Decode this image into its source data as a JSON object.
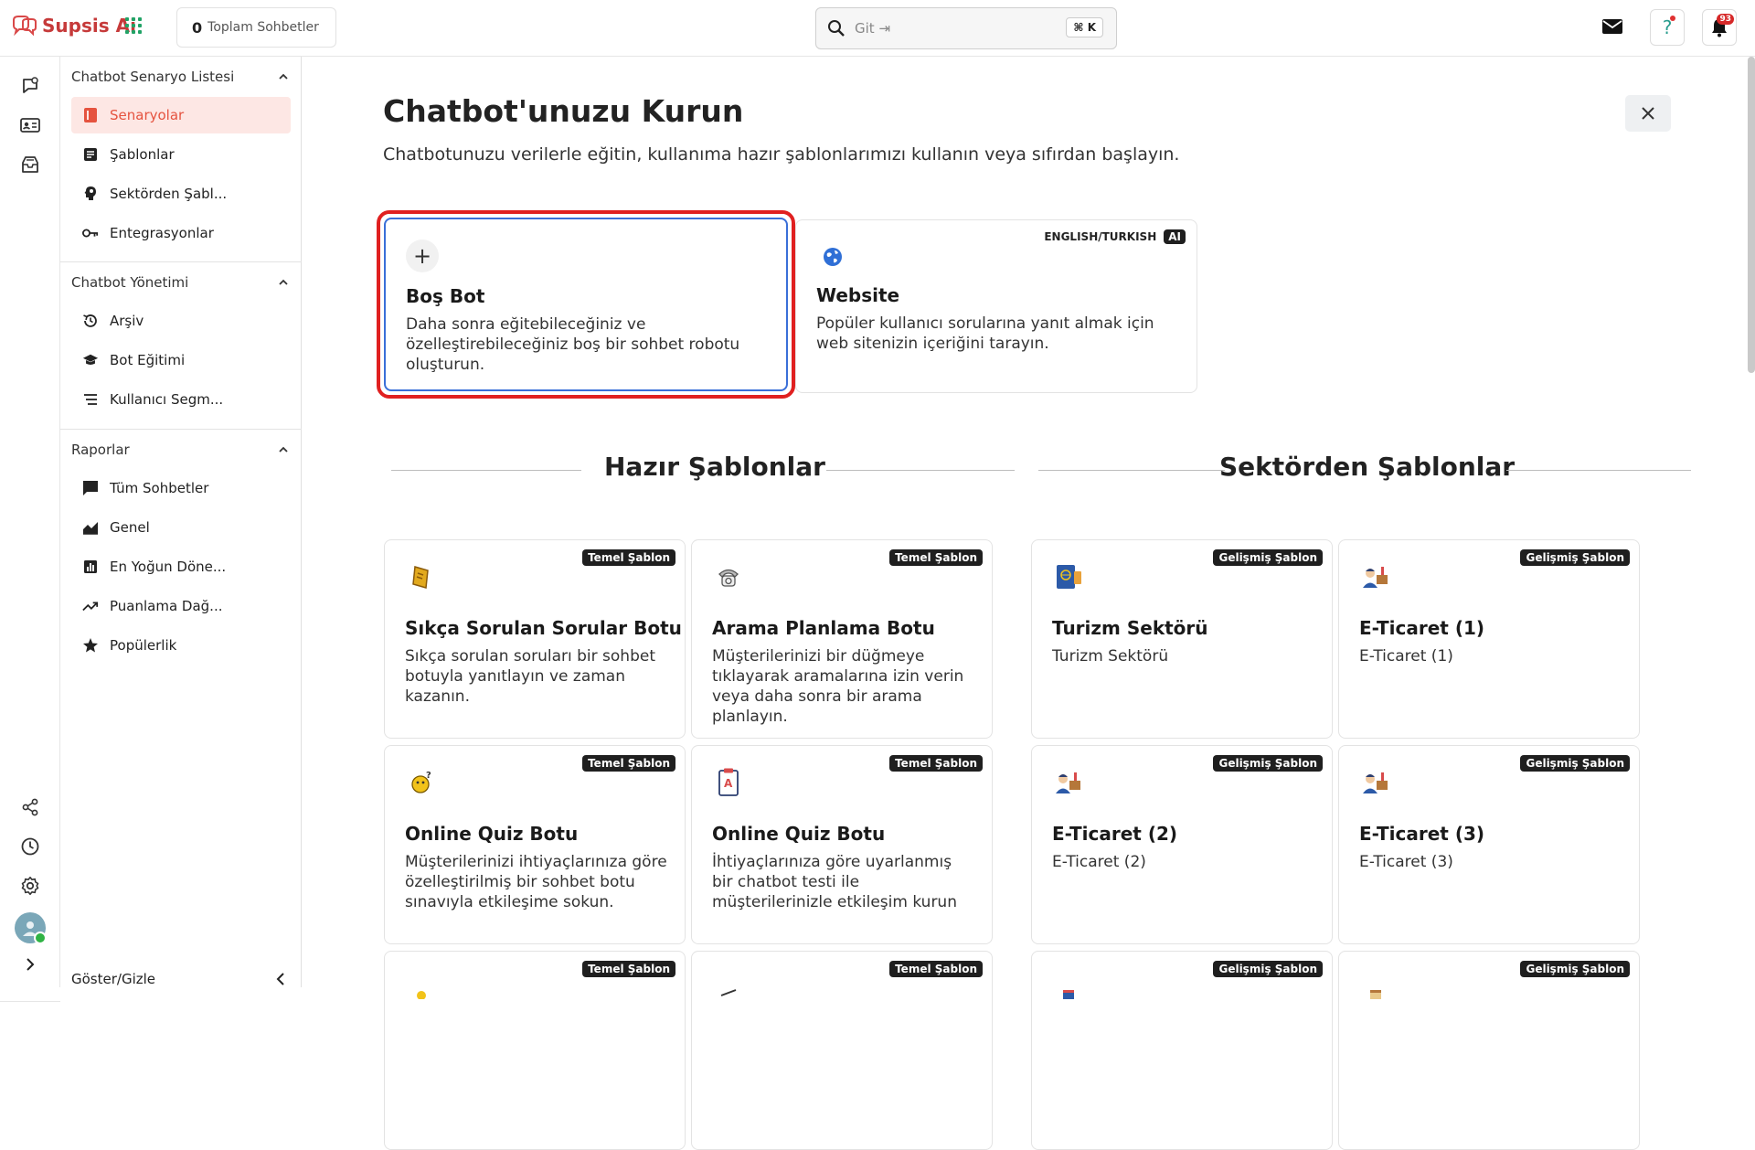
{
  "topbar": {
    "logo_text": "Supsis Ai",
    "total_count": "0",
    "total_label": "Toplam Sohbetler",
    "search_placeholder": "Git ⇥",
    "search_shortcut": "⌘ K",
    "notification_count": "93"
  },
  "sidebar": {
    "sections": [
      {
        "title": "Chatbot Senaryo Listesi",
        "items": [
          {
            "label": "Senaryolar",
            "icon": "scenario-icon",
            "active": true
          },
          {
            "label": "Şablonlar",
            "icon": "template-icon"
          },
          {
            "label": "Sektörden Şabl...",
            "icon": "sector-icon"
          },
          {
            "label": "Entegrasyonlar",
            "icon": "key-icon"
          }
        ]
      },
      {
        "title": "Chatbot Yönetimi",
        "items": [
          {
            "label": "Arşiv",
            "icon": "history-icon"
          },
          {
            "label": "Bot Eğitimi",
            "icon": "graduation-cap-icon"
          },
          {
            "label": "Kullanıcı Segm...",
            "icon": "segment-icon"
          }
        ]
      },
      {
        "title": "Raporlar",
        "items": [
          {
            "label": "Tüm Sohbetler",
            "icon": "chat-icon"
          },
          {
            "label": "Genel",
            "icon": "area-chart-icon"
          },
          {
            "label": "En Yoğun Döne...",
            "icon": "bar-chart-icon"
          },
          {
            "label": "Puanlama Dağ...",
            "icon": "trending-icon"
          },
          {
            "label": "Popülerlik",
            "icon": "star-icon"
          }
        ]
      }
    ],
    "toggle_label": "Göster/Gizle"
  },
  "main": {
    "title": "Chatbot'unuzu Kurun",
    "subtitle": "Chatbotunuzu verilerle eğitin, kullanıma hazır şablonlarımızı kullanın veya sıfırdan başlayın.",
    "start_cards": [
      {
        "title": "Boş Bot",
        "desc": "Daha sonra eğitebileceğiniz ve özelleştirebileceğiniz boş bir sohbet robotu oluşturun.",
        "icon": "plus-icon"
      },
      {
        "title": "Website",
        "desc": "Popüler kullanıcı sorularına yanıt almak için web sitenizin içeriğini tarayın.",
        "icon": "globe-icon",
        "lang": "ENGLISH/TURKISH",
        "ai": "AI"
      }
    ],
    "ready_title": "Hazır Şablonlar",
    "sector_title": "Sektörden Şablonlar",
    "ready_templates": [
      {
        "tag": "Temel Şablon",
        "title": "Sıkça Sorulan Sorular Botu",
        "desc": "Sıkça sorulan soruları bir sohbet botuyla yanıtlayın ve zaman kazanın."
      },
      {
        "tag": "Temel Şablon",
        "title": "Arama Planlama Botu",
        "desc": "Müşterilerinizi bir düğmeye tıklayarak aramalarına izin verin veya daha sonra bir arama planlayın."
      },
      {
        "tag": "Temel Şablon",
        "title": "Online Quiz Botu",
        "desc": "Müşterilerinizi ihtiyaçlarınıza göre özelleştirilmiş bir sohbet botu sınavıyla etkileşime sokun."
      },
      {
        "tag": "Temel Şablon",
        "title": "Online Quiz Botu",
        "desc": "İhtiyaçlarınıza göre uyarlanmış bir chatbot testi ile müşterilerinizle etkileşim kurun"
      },
      {
        "tag": "Temel Şablon"
      },
      {
        "tag": "Temel Şablon"
      }
    ],
    "sector_templates": [
      {
        "tag": "Gelişmiş Şablon",
        "title": "Turizm Sektörü",
        "desc": "Turizm Sektörü"
      },
      {
        "tag": "Gelişmiş Şablon",
        "title": "E-Ticaret (1)",
        "desc": "E-Ticaret (1)"
      },
      {
        "tag": "Gelişmiş Şablon",
        "title": "E-Ticaret (2)",
        "desc": "E-Ticaret (2)"
      },
      {
        "tag": "Gelişmiş Şablon",
        "title": "E-Ticaret (3)",
        "desc": "E-Ticaret (3)"
      },
      {
        "tag": "Gelişmiş Şablon"
      },
      {
        "tag": "Gelişmiş Şablon"
      }
    ]
  },
  "colors": {
    "accent": "#e5533f",
    "active_bg": "#fde7e4",
    "highlight": "#e02020",
    "selected_border": "#3a6fd8"
  }
}
